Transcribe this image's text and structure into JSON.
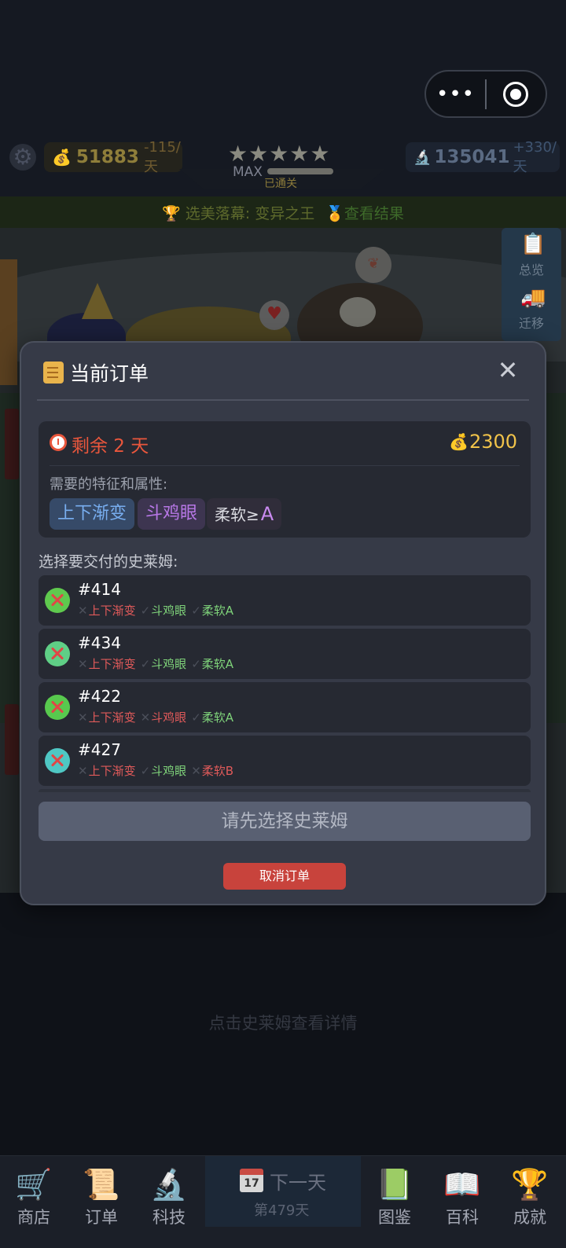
{
  "system": {
    "more_label": "•••"
  },
  "header": {
    "gold": "51883",
    "gold_rate": "-115/天",
    "stars": "★★★★★",
    "max_label": "MAX",
    "cleared_label": "已通关",
    "science": "135041",
    "science_rate": "+330/天"
  },
  "banner": {
    "text": "🏆 选美落幕: 变异之王",
    "result_label": "🏅查看结果"
  },
  "side": {
    "overview_label": "总览",
    "migrate_label": "迁移"
  },
  "modal": {
    "title": "当前订单",
    "close_glyph": "✕",
    "remaining": "剩余 2 天",
    "reward": "2300",
    "requirements_label": "需要的特征和属性:",
    "chips": [
      {
        "label": "上下渐变"
      },
      {
        "label": "斗鸡眼"
      },
      {
        "label": "柔软≥",
        "grade": "A"
      }
    ],
    "select_label": "选择要交付的史莱姆:",
    "slimes": [
      {
        "id": "#414",
        "badge_color": "#5fc94e",
        "traits": [
          {
            "mark": "✕",
            "text": "上下渐变",
            "ok": false
          },
          {
            "mark": "✓",
            "text": "斗鸡眼",
            "ok": true
          },
          {
            "mark": "✓",
            "text": "柔软A",
            "ok": true
          }
        ]
      },
      {
        "id": "#434",
        "badge_color": "#5fcf86",
        "traits": [
          {
            "mark": "✕",
            "text": "上下渐变",
            "ok": false
          },
          {
            "mark": "✓",
            "text": "斗鸡眼",
            "ok": true
          },
          {
            "mark": "✓",
            "text": "柔软A",
            "ok": true
          }
        ]
      },
      {
        "id": "#422",
        "badge_color": "#58c94e",
        "traits": [
          {
            "mark": "✕",
            "text": "上下渐变",
            "ok": false
          },
          {
            "mark": "✕",
            "text": "斗鸡眼",
            "ok": false
          },
          {
            "mark": "✓",
            "text": "柔软A",
            "ok": true
          }
        ]
      },
      {
        "id": "#427",
        "badge_color": "#4fc7c4",
        "traits": [
          {
            "mark": "✕",
            "text": "上下渐变",
            "ok": false
          },
          {
            "mark": "✓",
            "text": "斗鸡眼",
            "ok": true
          },
          {
            "mark": "✕",
            "text": "柔软B",
            "ok": false
          }
        ]
      }
    ],
    "confirm_label": "请先选择史莱姆",
    "cancel_label": "取消订单"
  },
  "hint": "点击史莱姆查看详情",
  "nav": {
    "items": [
      {
        "label": "商店",
        "icon": "🛒"
      },
      {
        "label": "订单",
        "icon": "📜"
      },
      {
        "label": "科技",
        "icon": "🔬"
      },
      {
        "label": "图鉴",
        "icon": "📗"
      },
      {
        "label": "百科",
        "icon": "📖"
      },
      {
        "label": "成就",
        "icon": "🏆"
      }
    ],
    "calendar_day": "17",
    "next_day_label": "下一天",
    "day_label": "第479天"
  }
}
